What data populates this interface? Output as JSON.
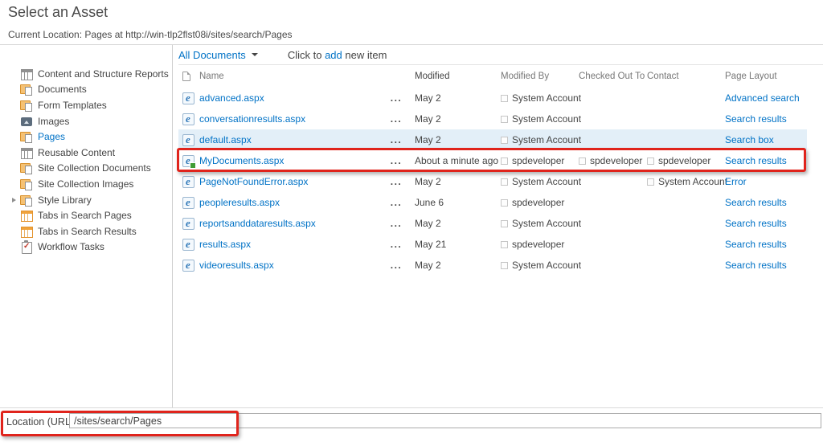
{
  "page": {
    "title": "Select an Asset",
    "current_location": "Current Location: Pages at http://win-tlp2flst08i/sites/search/Pages"
  },
  "sidebar": {
    "items": [
      {
        "label": "Content and Structure Reports",
        "icon": "table-icon",
        "selected": false,
        "expandable": false
      },
      {
        "label": "Documents",
        "icon": "library-icon",
        "selected": false,
        "expandable": false
      },
      {
        "label": "Form Templates",
        "icon": "library-icon",
        "selected": false,
        "expandable": false
      },
      {
        "label": "Images",
        "icon": "picture-icon",
        "selected": false,
        "expandable": false
      },
      {
        "label": "Pages",
        "icon": "library-icon",
        "selected": true,
        "expandable": false
      },
      {
        "label": "Reusable Content",
        "icon": "table-icon",
        "selected": false,
        "expandable": false
      },
      {
        "label": "Site Collection Documents",
        "icon": "library-icon",
        "selected": false,
        "expandable": false
      },
      {
        "label": "Site Collection Images",
        "icon": "library-icon",
        "selected": false,
        "expandable": false
      },
      {
        "label": "Style Library",
        "icon": "library-icon",
        "selected": false,
        "expandable": true
      },
      {
        "label": "Tabs in Search Pages",
        "icon": "orange-table-icon",
        "selected": false,
        "expandable": false
      },
      {
        "label": "Tabs in Search Results",
        "icon": "orange-table-icon",
        "selected": false,
        "expandable": false
      },
      {
        "label": "Workflow Tasks",
        "icon": "tasks-icon",
        "selected": false,
        "expandable": false
      }
    ]
  },
  "toolbar": {
    "view_selector": "All Documents",
    "add_prefix": "Click to",
    "add_link": "add",
    "add_suffix": "new item"
  },
  "table": {
    "columns": [
      "Name",
      "Modified",
      "Modified By",
      "Checked Out To",
      "Contact",
      "Page Layout"
    ],
    "ellipsis": "...",
    "rows": [
      {
        "name": "advanced.aspx",
        "modified": "May 2",
        "modified_by": "System Account",
        "checked_out_to": "",
        "contact": "",
        "page_layout": "Advanced search",
        "highlight": false,
        "new_badge": false,
        "annotated": false
      },
      {
        "name": "conversationresults.aspx",
        "modified": "May 2",
        "modified_by": "System Account",
        "checked_out_to": "",
        "contact": "",
        "page_layout": "Search results",
        "highlight": false,
        "new_badge": false,
        "annotated": false
      },
      {
        "name": "default.aspx",
        "modified": "May 2",
        "modified_by": "System Account",
        "checked_out_to": "",
        "contact": "",
        "page_layout": "Search box",
        "highlight": true,
        "new_badge": false,
        "annotated": false
      },
      {
        "name": "MyDocuments.aspx",
        "modified": "About a minute ago",
        "modified_by": "spdeveloper",
        "checked_out_to": "spdeveloper",
        "contact": "spdeveloper",
        "page_layout": "Search results",
        "highlight": false,
        "new_badge": true,
        "annotated": true
      },
      {
        "name": "PageNotFoundError.aspx",
        "modified": "May 2",
        "modified_by": "System Account",
        "checked_out_to": "",
        "contact": "System Account",
        "page_layout": "Error",
        "highlight": false,
        "new_badge": false,
        "annotated": false
      },
      {
        "name": "peopleresults.aspx",
        "modified": "June 6",
        "modified_by": "spdeveloper",
        "checked_out_to": "",
        "contact": "",
        "page_layout": "Search results",
        "highlight": false,
        "new_badge": false,
        "annotated": false
      },
      {
        "name": "reportsanddataresults.aspx",
        "modified": "May 2",
        "modified_by": "System Account",
        "checked_out_to": "",
        "contact": "",
        "page_layout": "Search results",
        "highlight": false,
        "new_badge": false,
        "annotated": false
      },
      {
        "name": "results.aspx",
        "modified": "May 21",
        "modified_by": "spdeveloper",
        "checked_out_to": "",
        "contact": "",
        "page_layout": "Search results",
        "highlight": false,
        "new_badge": false,
        "annotated": false
      },
      {
        "name": "videoresults.aspx",
        "modified": "May 2",
        "modified_by": "System Account",
        "checked_out_to": "",
        "contact": "",
        "page_layout": "Search results",
        "highlight": false,
        "new_badge": false,
        "annotated": false
      }
    ]
  },
  "footer": {
    "location_label": "Location (URL):",
    "location_value": "/sites/search/Pages"
  },
  "colors": {
    "link_blue": "#0072c6",
    "annotation_red": "#e0241c",
    "row_highlight": "#e3eff8"
  }
}
